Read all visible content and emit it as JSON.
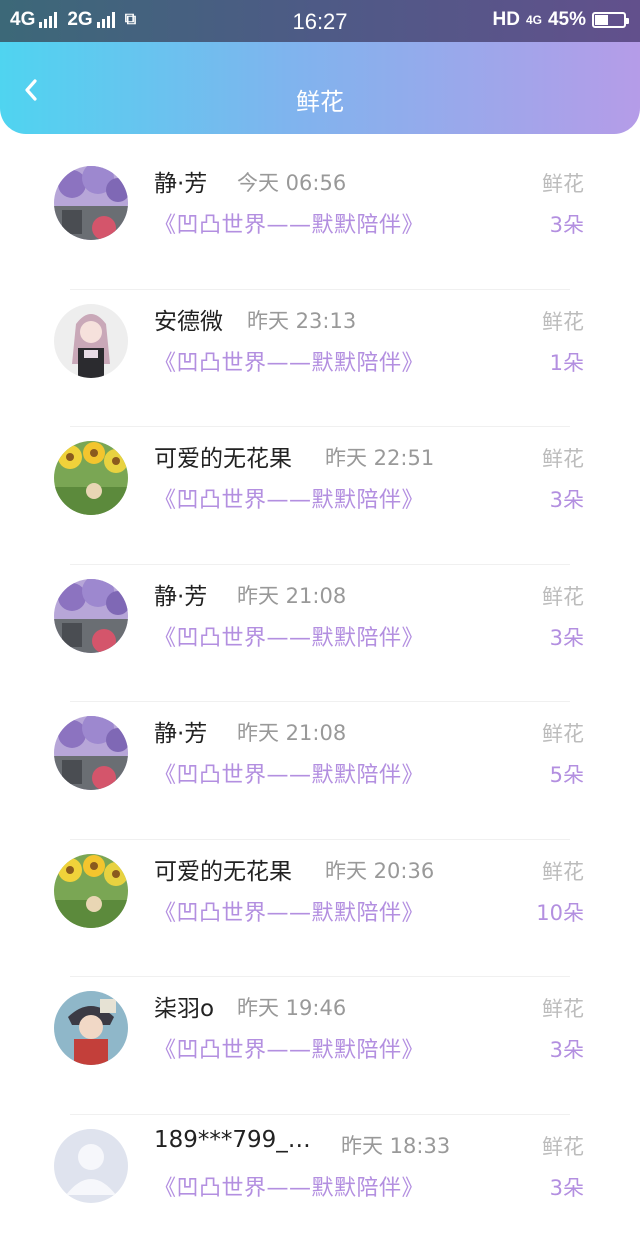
{
  "status_bar": {
    "net1": "4G",
    "net2": "2G",
    "time": "16:27",
    "hd": "HD",
    "net3": "4G",
    "battery": "45%"
  },
  "header": {
    "title": "鲜花"
  },
  "items": [
    {
      "name": "静·芳",
      "time": "今天 06:56",
      "song": "《凹凸世界——默默陪伴》",
      "gift": "鲜花",
      "count": "3朵"
    },
    {
      "name": "安德微",
      "time": "昨天 23:13",
      "song": "《凹凸世界——默默陪伴》",
      "gift": "鲜花",
      "count": "1朵"
    },
    {
      "name": "可爱的无花果",
      "time": "昨天 22:51",
      "song": "《凹凸世界——默默陪伴》",
      "gift": "鲜花",
      "count": "3朵"
    },
    {
      "name": "静·芳",
      "time": "昨天 21:08",
      "song": "《凹凸世界——默默陪伴》",
      "gift": "鲜花",
      "count": "3朵"
    },
    {
      "name": "静·芳",
      "time": "昨天 21:08",
      "song": "《凹凸世界——默默陪伴》",
      "gift": "鲜花",
      "count": "5朵"
    },
    {
      "name": "可爱的无花果",
      "time": "昨天 20:36",
      "song": "《凹凸世界——默默陪伴》",
      "gift": "鲜花",
      "count": "10朵"
    },
    {
      "name": "柒羽o",
      "time": "昨天 19:46",
      "song": "《凹凸世界——默默陪伴》",
      "gift": "鲜花",
      "count": "3朵"
    },
    {
      "name": "189***799_…",
      "time": "昨天 18:33",
      "song": "《凹凸世界——默默陪伴》",
      "gift": "鲜花",
      "count": "3朵"
    }
  ]
}
